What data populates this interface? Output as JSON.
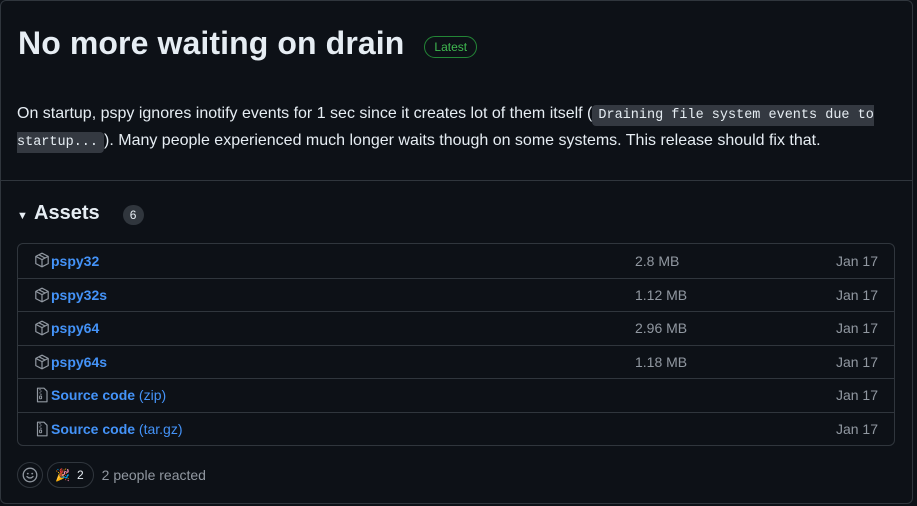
{
  "release": {
    "title": "No more waiting on drain",
    "badge": "Latest",
    "body_before": "On startup, pspy ignores inotify events for 1 sec since it creates lot of them itself (",
    "body_code_line1": "Draining file system events due to",
    "body_code_line2": "startup...",
    "body_after": "). Many people experienced much longer waits though on some systems. This release should fix that."
  },
  "assets": {
    "title": "Assets",
    "count": "6",
    "items": [
      {
        "name": "pspy32",
        "ext": "",
        "size": "2.8 MB",
        "date": "Jan 17",
        "icon": "package-icon"
      },
      {
        "name": "pspy32s",
        "ext": "",
        "size": "1.12 MB",
        "date": "Jan 17",
        "icon": "package-icon"
      },
      {
        "name": "pspy64",
        "ext": "",
        "size": "2.96 MB",
        "date": "Jan 17",
        "icon": "package-icon"
      },
      {
        "name": "pspy64s",
        "ext": "",
        "size": "1.18 MB",
        "date": "Jan 17",
        "icon": "package-icon"
      },
      {
        "name": "Source code",
        "ext": "(zip)",
        "size": "",
        "date": "Jan 17",
        "icon": "file-zip-icon"
      },
      {
        "name": "Source code",
        "ext": "(tar.gz)",
        "size": "",
        "date": "Jan 17",
        "icon": "file-zip-icon"
      }
    ]
  },
  "reactions": {
    "emoji": "🎉",
    "count": "2",
    "summary": "2 people reacted"
  }
}
